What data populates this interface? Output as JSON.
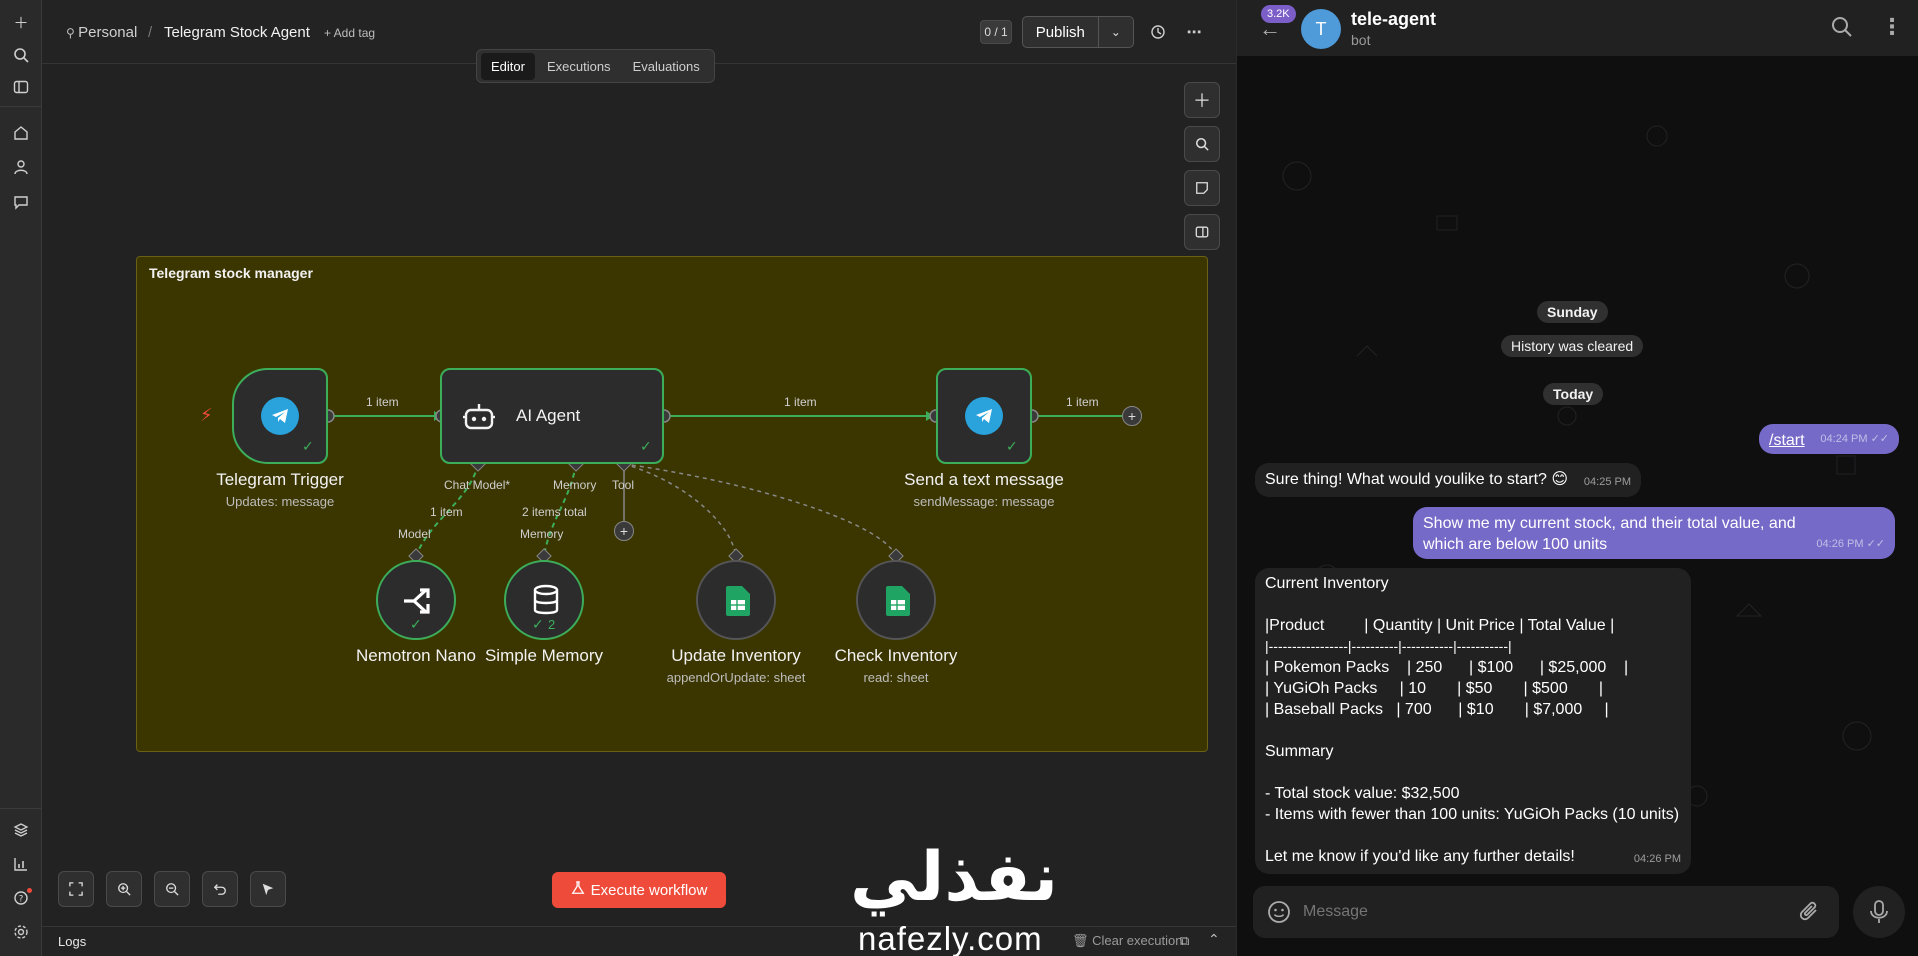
{
  "n8n": {
    "breadcrumb": {
      "project": "Personal",
      "separator": "/",
      "workflow": "Telegram Stock Agent",
      "add_tag": "+ Add tag"
    },
    "tabs": [
      "Editor",
      "Executions",
      "Evaluations"
    ],
    "active_tab": "Editor",
    "versions": "0 / 1",
    "publish_label": "Publish",
    "sticky_title": "Telegram stock manager",
    "nodes": {
      "trigger": {
        "label": "Telegram Trigger",
        "sub": "Updates: message"
      },
      "agent": {
        "label": "AI Agent"
      },
      "send": {
        "label": "Send a text message",
        "sub": "sendMessage: message"
      },
      "model": {
        "label": "Nemotron Nano"
      },
      "memory": {
        "label": "Simple Memory",
        "badge": "2"
      },
      "update": {
        "label": "Update Inventory",
        "sub": "appendOrUpdate: sheet"
      },
      "check": {
        "label": "Check Inventory",
        "sub": "read: sheet"
      }
    },
    "edge_labels": {
      "trigger_agent": "1 item",
      "agent_send": "1 item",
      "send_out": "1 item",
      "chat_model": "Chat Model*",
      "memory": "Memory",
      "tool": "Tool",
      "model_items": "1 item",
      "memory_items": "2 items total",
      "model_port": "Model",
      "memory_port": "Memory"
    },
    "execute_label": "Execute workflow",
    "logs_label": "Logs",
    "clear_execution": "Clear execution",
    "watermark_ar": "نفذلي",
    "watermark_en": "nafezly.com",
    "colors": {
      "accent_green": "#3cae5a",
      "execute_red": "#ef4b3a",
      "sticky_bg": "#3b3500",
      "telegram_blue": "#2aa2db",
      "sheets_green": "#1fa463"
    }
  },
  "telegram": {
    "unread": "3.2K",
    "avatar_letter": "T",
    "title": "tele-agent",
    "subtitle": "bot",
    "pills": {
      "sunday": "Sunday",
      "cleared": "History was cleared",
      "today": "Today"
    },
    "messages": [
      {
        "dir": "out",
        "text": "/start",
        "time": "04:24 PM"
      },
      {
        "dir": "in",
        "text": "Sure thing! What would youlike to start? 😊",
        "time": "04:25 PM"
      },
      {
        "dir": "out",
        "text": "Show me my current stock, and their total value, and which are below 100 units",
        "time": "04:26 PM"
      }
    ],
    "inventory": {
      "heading": "Current Inventory",
      "lines": [
        "|Product         | Quantity | Unit Price | Total Value |",
        "|-----------------|----------|-----------|-----------|",
        "| Pokemon Packs    | 250      | $100      | $25,000    |",
        "| YuGiOh Packs     | 10       | $50       | $500       |",
        "| Baseball Packs   | 700      | $10       | $7,000     |"
      ],
      "summary_heading": "Summary",
      "summary_lines": [
        "- Total stock value: $32,500",
        "- Items with fewer than 100 units: YuGiOh Packs (10 units)"
      ],
      "closing": "Let me know if you'd like any further details!",
      "time": "04:26 PM"
    },
    "composer_placeholder": "Message",
    "colors": {
      "outgoing": "#766ac8",
      "incoming": "#212121"
    }
  }
}
